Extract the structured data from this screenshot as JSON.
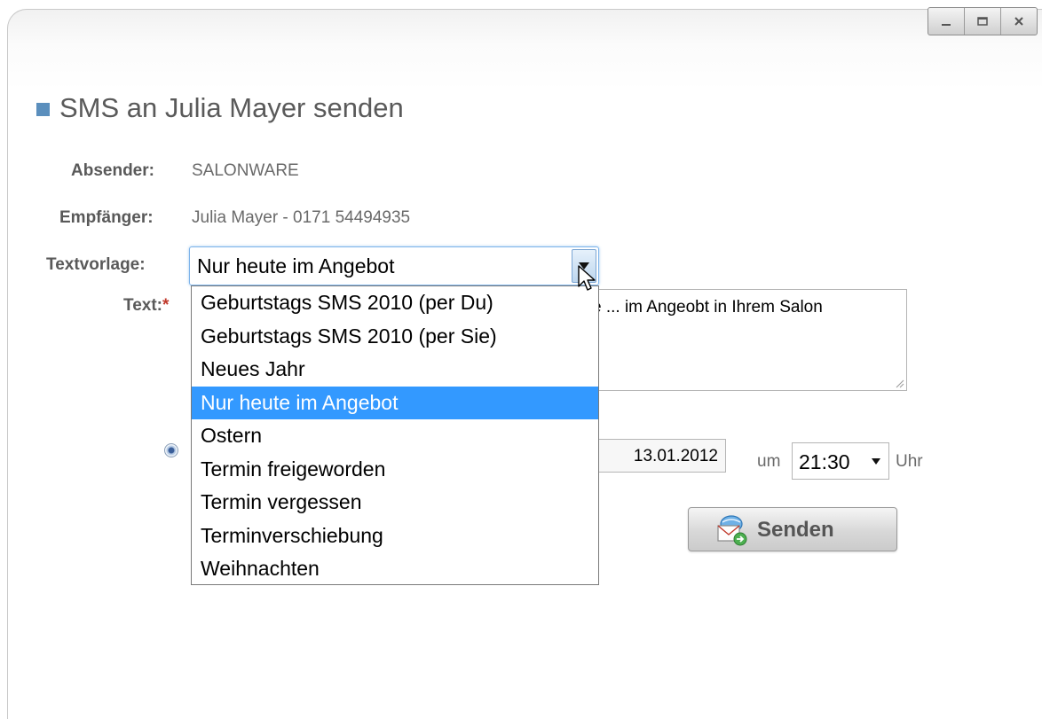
{
  "window": {
    "controls": [
      "minimize",
      "maximize",
      "close"
    ]
  },
  "header": {
    "title": "SMS an Julia Mayer senden"
  },
  "form": {
    "absender_label": "Absender:",
    "absender_value": "SALONWARE",
    "empfaenger_label": "Empfänger:",
    "empfaenger_value": "Julia Mayer - 0171 54494935",
    "textvorlage_label": "Textvorlage:",
    "textvorlage_value": "Nur heute im Angebot",
    "text_label": "Text:",
    "text_required_mark": "*",
    "text_visible": "e ... im Angeobt in Ihrem Salon",
    "date_value": "13.01.2012",
    "um_label": "um",
    "time_value": "21:30",
    "uhr_label": "Uhr",
    "send_label": "Senden"
  },
  "dropdown": {
    "options": [
      "Geburtstags SMS 2010 (per Du)",
      "Geburtstags SMS 2010 (per Sie)",
      "Neues Jahr",
      "Nur heute im Angebot",
      "Ostern",
      "Termin freigeworden",
      "Termin vergessen",
      "Terminverschiebung",
      "Weihnachten"
    ],
    "selected": "Nur heute im Angebot"
  },
  "colors": {
    "accent": "#5b8fbd",
    "selection": "#3399ff",
    "required": "#c0392b"
  }
}
